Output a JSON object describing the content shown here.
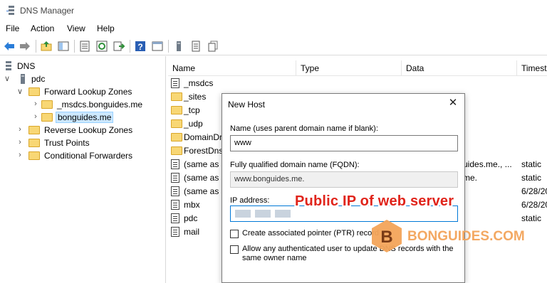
{
  "window": {
    "title": "DNS Manager"
  },
  "menu": [
    "File",
    "Action",
    "View",
    "Help"
  ],
  "toolbar": {
    "icons": [
      "back-arrow-icon",
      "forward-arrow-icon",
      "up-folder-icon",
      "show-hide-tree-icon",
      "properties-icon",
      "refresh-icon",
      "export-list-icon",
      "help-icon",
      "console-icon",
      "server-icon",
      "record-icon",
      "record-copy-icon"
    ]
  },
  "tree": {
    "root": "DNS",
    "server": "pdc",
    "forward_zones": "Forward Lookup Zones",
    "zone_msdcs": "_msdcs.bonguides.me",
    "zone_selected": "bonguides.me",
    "reverse_zones": "Reverse Lookup Zones",
    "trust_points": "Trust Points",
    "conditional_forwarders": "Conditional Forwarders"
  },
  "list": {
    "columns": [
      "Name",
      "Type",
      "Data",
      "Timest"
    ],
    "rows": [
      {
        "name": "_msdcs",
        "kind": "folder",
        "data": "",
        "ts": ""
      },
      {
        "name": "_sites",
        "kind": "folder",
        "data": "",
        "ts": ""
      },
      {
        "name": "_tcp",
        "kind": "folder",
        "data": "",
        "ts": ""
      },
      {
        "name": "_udp",
        "kind": "folder",
        "data": "",
        "ts": ""
      },
      {
        "name": "DomainDr",
        "kind": "folder",
        "data": "",
        "ts": ""
      },
      {
        "name": "ForestDnsz",
        "kind": "folder",
        "data": "",
        "ts": ""
      },
      {
        "name": "(same as p",
        "kind": "record",
        "data": "uides.me., ...",
        "ts": "static"
      },
      {
        "name": "(same as p",
        "kind": "record",
        "data": "me.",
        "ts": "static"
      },
      {
        "name": "(same as p",
        "kind": "record",
        "data": "",
        "ts": "6/28/20"
      },
      {
        "name": "mbx",
        "kind": "record",
        "data": "",
        "ts": "6/28/20"
      },
      {
        "name": "pdc",
        "kind": "record",
        "data": "",
        "ts": "static"
      },
      {
        "name": "mail",
        "kind": "record",
        "data": "",
        "ts": ""
      }
    ]
  },
  "dialog": {
    "title": "New Host",
    "name_label": "Name (uses parent domain name if blank):",
    "name_value": "www",
    "fqdn_label": "Fully qualified domain name (FQDN):",
    "fqdn_value": "www.bonguides.me.",
    "ip_label": "IP address:",
    "ptr_label": "Create associated pointer (PTR) record",
    "ptr_checked": false,
    "allow_label": "Allow any authenticated user to update DNS records with the same owner name",
    "allow_checked": false
  },
  "annotation": {
    "text": "Public IP of web server",
    "color": "#e0241b"
  },
  "watermark": {
    "text": "BONGUIDES.COM",
    "color": "#f3a45a"
  }
}
